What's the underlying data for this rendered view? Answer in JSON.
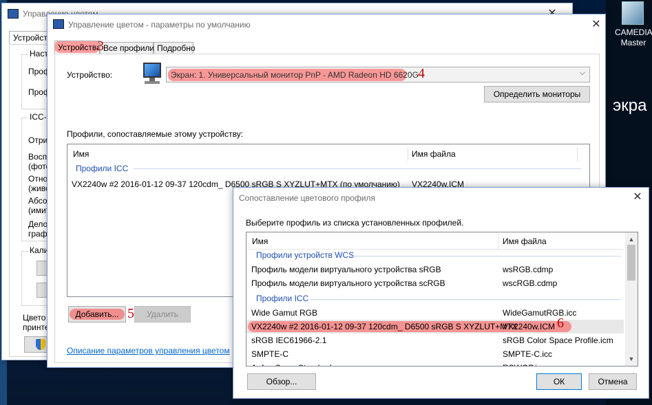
{
  "desktop": {
    "icon_label_line1": "CAMEDIA",
    "icon_label_line2": "Master",
    "partial_text": "экра"
  },
  "back_window": {
    "title": "Управление цветом",
    "tab_label": "Устройства",
    "group1_label": "Наст",
    "group1_line1": "Проф",
    "group1_line2": "Проф",
    "group2_label": "ICC-",
    "lines": [
      "Отри",
      "Восп",
      "(фото",
      "Отно",
      "(живо",
      "Абсо",
      "(имит",
      "Дело",
      "граф"
    ],
    "group3_label": "Кали",
    "bottom_line1": "Цвето",
    "bottom_line2": "принте"
  },
  "main_window": {
    "title": "Управление цветом - параметры по умолчанию",
    "tabs": [
      "Устройства",
      "Все профили",
      "Подробно"
    ],
    "device_label": "Устройство:",
    "device_value": "Экран: 1. Универсальный монитор PnP - AMD Radeon HD 6620G",
    "identify_button": "Определить мониторы",
    "profiles_label": "Профили, сопоставляемые этому устройству:",
    "columns": [
      "Имя",
      "Имя файла"
    ],
    "group_label": "Профили ICC",
    "rows": [
      {
        "name": "VX2240w #2 2016-01-12 09-37 120cdm_ D6500 sRGB S XYZLUT+MTX (по умолчанию)",
        "file": "VX2240w.ICM"
      }
    ],
    "add_button": "Добавить...",
    "remove_button": "Удалить",
    "help_link": "Описание параметров управления цветом"
  },
  "dialog": {
    "title": "Сопоставление цветового профиля",
    "instruction": "Выберите профиль из списка установленных профилей.",
    "columns": [
      "Имя",
      "Имя файла"
    ],
    "group_wcs": "Профили устройств WCS",
    "wcs_rows": [
      {
        "name": "Профиль модели виртуального устройства sRGB",
        "file": "wsRGB.cdmp"
      },
      {
        "name": "Профиль модели виртуального устройства scRGB",
        "file": "wscRGB.cdmp"
      }
    ],
    "group_icc": "Профили ICC",
    "icc_rows": [
      {
        "name": "Wide Gamut RGB",
        "file": "WideGamutRGB.icc"
      },
      {
        "name": "VX2240w #2 2016-01-12 09-37 120cdm_ D6500 sRGB S XYZLUT+MTX",
        "file": "VX2240w.ICM"
      },
      {
        "name": "sRGB IEC61966-2.1",
        "file": "sRGB Color Space Profile.icm"
      },
      {
        "name": "SMPTE-C",
        "file": "SMPTE-C.icc"
      },
      {
        "name": "Agfa : Swop Standard",
        "file": "RSWOP.icm"
      }
    ],
    "browse_button": "Обзор...",
    "ok_button": "ОК",
    "cancel_button": "Отмена"
  },
  "annotations": [
    "3",
    "4",
    "5",
    "6"
  ],
  "colors": {
    "highlight": "#ff3c3c",
    "annotation": "#c00000",
    "group_label": "#1e4fb3",
    "link": "#0066cc",
    "desktop": "#0a1a33"
  }
}
